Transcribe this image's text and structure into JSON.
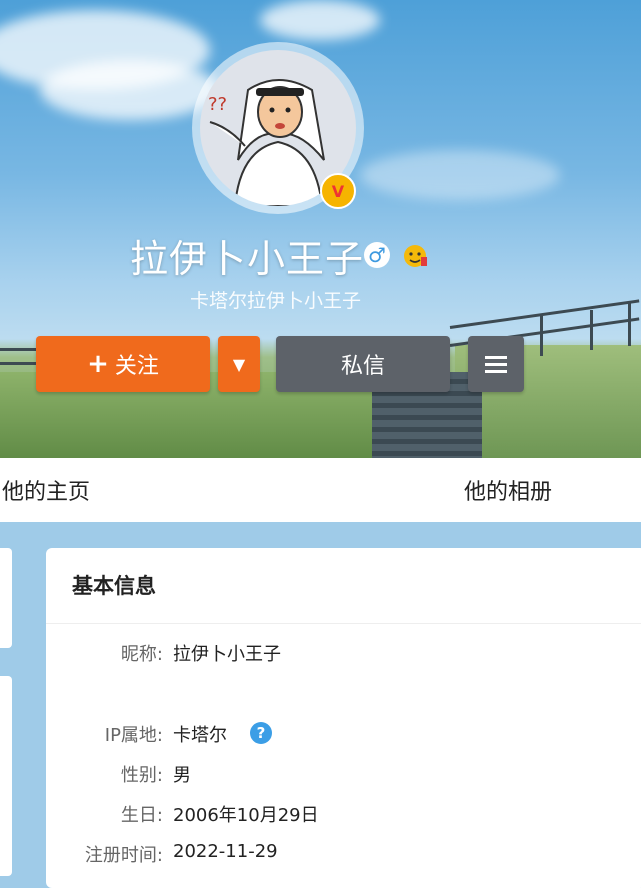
{
  "profile": {
    "name": "拉伊卜小王子",
    "gender_symbol": "♂",
    "subtitle": "卡塔尔拉伊卜小王子",
    "verified_badge": "V"
  },
  "actions": {
    "follow_plus": "+",
    "follow_label": "关注",
    "dropdown_icon": "▼",
    "message_label": "私信"
  },
  "nav": {
    "home": "他的主页",
    "album": "他的相册"
  },
  "info_card": {
    "title": "基本信息",
    "rows": [
      {
        "label": "昵称:",
        "value": "拉伊卜小王子"
      },
      {
        "label": "IP属地:",
        "value": "卡塔尔"
      },
      {
        "label": "性别:",
        "value": "男"
      },
      {
        "label": "生日:",
        "value": "2006年10月29日"
      },
      {
        "label": "注册时间:",
        "value": "2022-11-29"
      }
    ],
    "help_icon": "?"
  },
  "colors": {
    "follow_orange": "#f06a1c",
    "message_gray": "#5d6269",
    "help_blue": "#3b9ee6",
    "page_bg": "#9fcbe8"
  }
}
